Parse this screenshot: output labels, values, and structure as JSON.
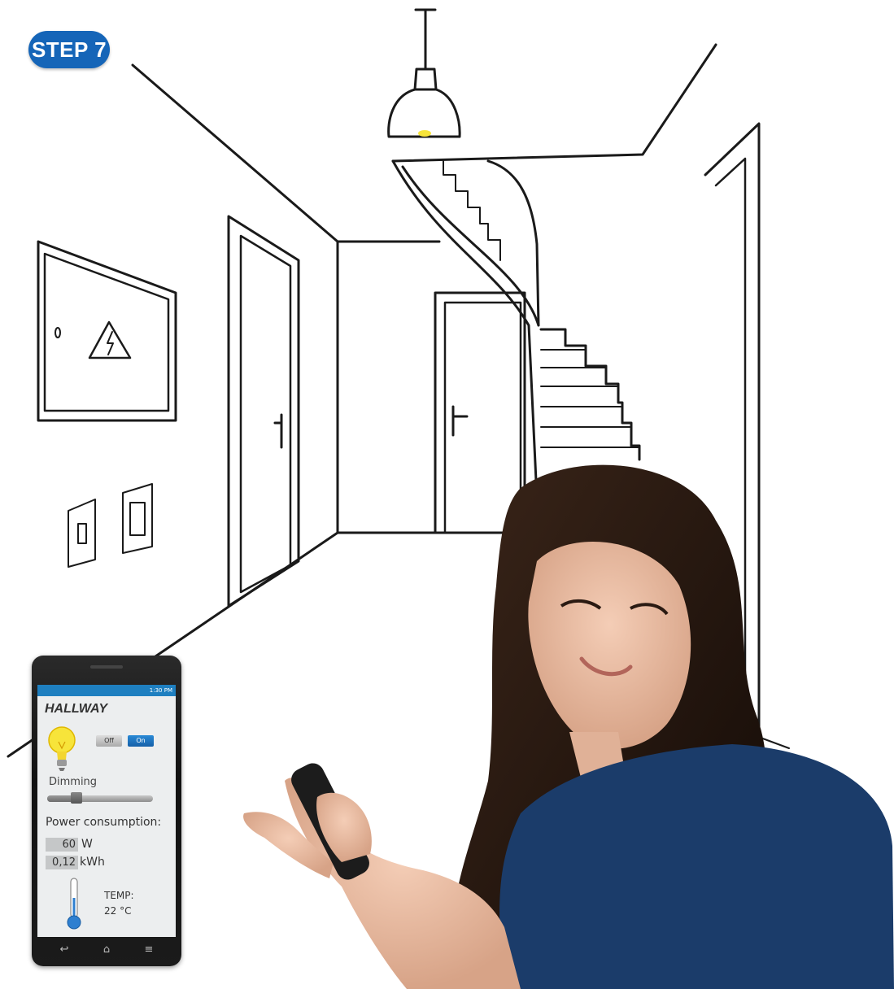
{
  "step": {
    "label": "STEP 7"
  },
  "phone": {
    "status_time": "1:30 PM",
    "room": "HALLWAY",
    "light": {
      "off_label": "Off",
      "on_label": "On",
      "state": "on"
    },
    "dimming": {
      "label": "Dimming",
      "level": 0.28
    },
    "power": {
      "label": "Power consumption:",
      "watts": {
        "value": "60",
        "unit": "W"
      },
      "energy": {
        "value": "0,12",
        "unit": "kWh"
      }
    },
    "temperature": {
      "label": "TEMP:",
      "value": "22 °C"
    },
    "nav": {
      "back_icon": "back-arrow-icon",
      "home_icon": "home-icon",
      "menu_icon": "menu-icon"
    }
  },
  "colors": {
    "brand_blue": "#1565b8",
    "on_button": "#1f75c2",
    "status_bar": "#1e7fc0",
    "bulb_yellow": "#f7e43a",
    "thermo_blue": "#2e7fd0",
    "top_blue": "#1b4f7a"
  }
}
